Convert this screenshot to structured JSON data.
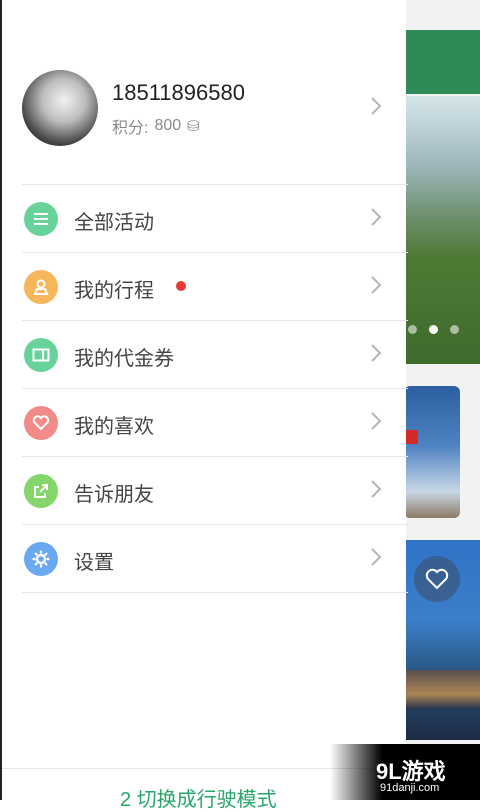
{
  "profile": {
    "phone": "18511896580",
    "points_label": "积分:",
    "points_value": "800",
    "coin_icon": "⛁"
  },
  "menu": {
    "items": [
      {
        "label": "全部活动",
        "icon": "list-icon",
        "color": "#67d39b"
      },
      {
        "label": "我的行程",
        "icon": "user-badge-icon",
        "color": "#f6b75a"
      },
      {
        "label": "我的代金券",
        "icon": "voucher-icon",
        "color": "#67d39b"
      },
      {
        "label": "我的喜欢",
        "icon": "heart-icon",
        "color": "#f38a8a"
      },
      {
        "label": "告诉朋友",
        "icon": "share-icon",
        "color": "#84d66a"
      },
      {
        "label": "设置",
        "icon": "gear-icon",
        "color": "#6aa9f2"
      }
    ]
  },
  "bottom_link": "2 切换成行驶模式",
  "watermark": {
    "logo": "9L游戏",
    "url": "91danji.com"
  },
  "colors": {
    "accent_green": "#2aa66b",
    "notification_red": "#e53935",
    "topbar_green": "#2e8b57"
  }
}
